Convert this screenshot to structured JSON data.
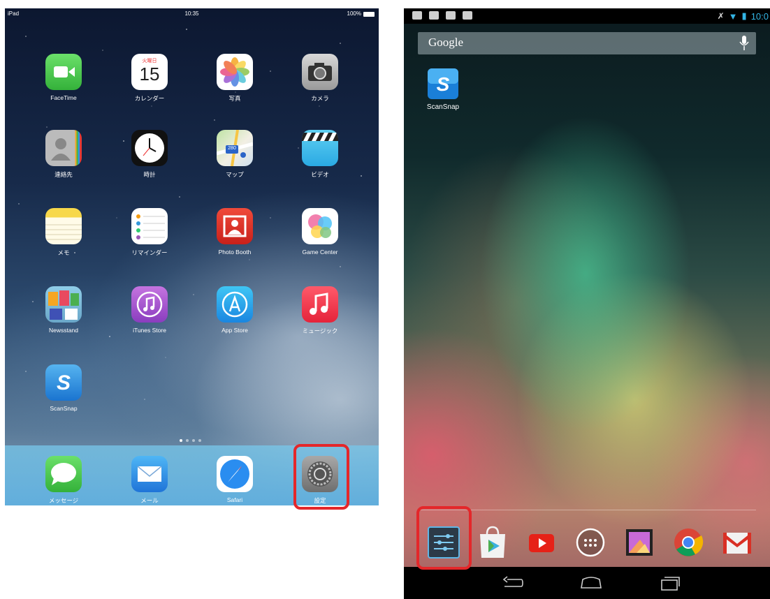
{
  "ipad": {
    "status": {
      "carrier": "iPad",
      "time": "10:35",
      "battery": "100%"
    },
    "apps": [
      {
        "name": "facetime",
        "label": "FaceTime"
      },
      {
        "name": "calendar",
        "label": "カレンダー",
        "weekday": "火曜日",
        "day": "15"
      },
      {
        "name": "photos",
        "label": "写真"
      },
      {
        "name": "camera",
        "label": "カメラ"
      },
      {
        "name": "contacts",
        "label": "連絡先"
      },
      {
        "name": "clock",
        "label": "時計"
      },
      {
        "name": "maps",
        "label": "マップ",
        "road": "280"
      },
      {
        "name": "videos",
        "label": "ビデオ"
      },
      {
        "name": "notes",
        "label": "メモ"
      },
      {
        "name": "reminders",
        "label": "リマインダー"
      },
      {
        "name": "photo-booth",
        "label": "Photo Booth"
      },
      {
        "name": "game-center",
        "label": "Game Center"
      },
      {
        "name": "newsstand",
        "label": "Newsstand"
      },
      {
        "name": "itunes-store",
        "label": "iTunes Store"
      },
      {
        "name": "app-store",
        "label": "App Store"
      },
      {
        "name": "music",
        "label": "ミュージック"
      },
      {
        "name": "scansnap",
        "label": "ScanSnap"
      }
    ],
    "dock": [
      {
        "name": "messages",
        "label": "メッセージ"
      },
      {
        "name": "mail",
        "label": "メール"
      },
      {
        "name": "safari",
        "label": "Safari"
      },
      {
        "name": "settings",
        "label": "設定"
      }
    ],
    "page_count": 4,
    "current_page": 1
  },
  "android": {
    "status": {
      "time": "10:0"
    },
    "search": {
      "label": "Google"
    },
    "apps": [
      {
        "name": "scansnap",
        "label": "ScanSnap"
      }
    ],
    "hotseat": [
      "settings",
      "play-store",
      "youtube",
      "app-drawer",
      "gallery",
      "chrome",
      "gmail"
    ]
  },
  "colors": {
    "highlight": "#e4272a",
    "holo_blue": "#33b5e5"
  }
}
